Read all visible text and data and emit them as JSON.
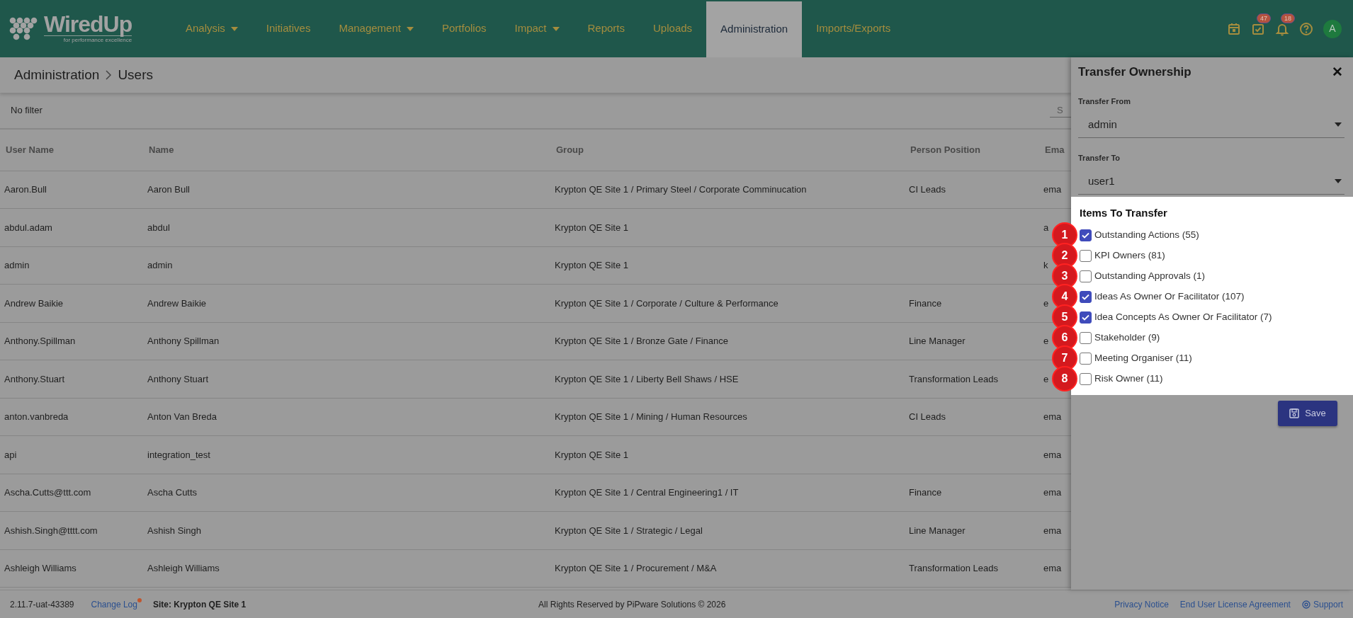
{
  "brand": {
    "name": "WiredUp",
    "tagline": "for performance excellence"
  },
  "nav": [
    {
      "label": "Analysis",
      "dropdown": true,
      "selected": false
    },
    {
      "label": "Initiatives",
      "dropdown": false,
      "selected": false
    },
    {
      "label": "Management",
      "dropdown": true,
      "selected": false
    },
    {
      "label": "Portfolios",
      "dropdown": false,
      "selected": false
    },
    {
      "label": "Impact",
      "dropdown": true,
      "selected": false
    },
    {
      "label": "Reports",
      "dropdown": false,
      "selected": false
    },
    {
      "label": "Uploads",
      "dropdown": false,
      "selected": false
    },
    {
      "label": "Administration",
      "dropdown": false,
      "selected": true
    },
    {
      "label": "Imports/Exports",
      "dropdown": false,
      "selected": false
    }
  ],
  "header_icons": [
    {
      "kind": "calendar"
    },
    {
      "kind": "tasks",
      "badge": "47"
    },
    {
      "kind": "bell",
      "badge": "18"
    },
    {
      "kind": "help"
    },
    {
      "kind": "avatar",
      "label": "A"
    }
  ],
  "breadcrumb": [
    "Administration",
    "Users"
  ],
  "filter": {
    "label": "No filter",
    "search_placeholder": "S"
  },
  "table": {
    "columns": [
      "User Name",
      "Name",
      "Group",
      "Person Position",
      "Ema"
    ],
    "rows": [
      [
        "Aaron.Bull",
        "Aaron Bull",
        "Krypton QE Site 1 / Primary Steel / Corporate Comminucation",
        "CI Leads",
        "ema"
      ],
      [
        "abdul.adam",
        "abdul",
        "Krypton QE Site 1",
        "",
        "a"
      ],
      [
        "admin",
        "admin",
        "Krypton QE Site 1",
        "",
        "k"
      ],
      [
        "Andrew Baikie",
        "Andrew Baikie",
        "Krypton QE Site 1 / Corporate / Culture & Performance",
        "Finance",
        "e"
      ],
      [
        "Anthony.Spillman",
        "Anthony Spillman",
        "Krypton QE Site 1 / Bronze Gate / Finance",
        "Line Manager",
        "e"
      ],
      [
        "Anthony.Stuart",
        "Anthony Stuart",
        "Krypton QE Site 1 / Liberty Bell Shaws / HSE",
        "Transformation Leads",
        "e"
      ],
      [
        "anton.vanbreda",
        "Anton Van Breda",
        "Krypton QE Site 1 / Mining / Human Resources",
        "CI Leads",
        "ema"
      ],
      [
        "api",
        "integration_test",
        "Krypton QE Site 1",
        "",
        "ema"
      ],
      [
        "Ascha.Cutts@ttt.com",
        "Ascha Cutts",
        "Krypton QE Site 1 / Central Engineering1 / IT",
        "Finance",
        "ema"
      ],
      [
        "Ashish.Singh@tttt.com",
        "Ashish Singh",
        "Krypton QE Site 1 / Strategic / Legal",
        "Line Manager",
        "ema"
      ],
      [
        "Ashleigh Williams",
        "Ashleigh Williams",
        "Krypton QE Site 1 / Procurement / M&A",
        "Transformation Leads",
        "ema"
      ]
    ]
  },
  "panel": {
    "title": "Transfer Ownership",
    "close": "✕",
    "fields": [
      {
        "label": "Transfer From",
        "value": "admin"
      },
      {
        "label": "Transfer To",
        "value": "user1"
      }
    ],
    "items_title": "Items To Transfer",
    "items": [
      {
        "marker": "1",
        "label": "Outstanding Actions (55)",
        "checked": true
      },
      {
        "marker": "2",
        "label": "KPI Owners (81)",
        "checked": false
      },
      {
        "marker": "3",
        "label": "Outstanding Approvals (1)",
        "checked": false
      },
      {
        "marker": "4",
        "label": "Ideas As Owner Or Facilitator (107)",
        "checked": true
      },
      {
        "marker": "5",
        "label": "Idea Concepts As Owner Or Facilitator (7)",
        "checked": true
      },
      {
        "marker": "6",
        "label": "Stakeholder (9)",
        "checked": false
      },
      {
        "marker": "7",
        "label": "Meeting Organiser (11)",
        "checked": false
      },
      {
        "marker": "8",
        "label": "Risk Owner (11)",
        "checked": false
      }
    ],
    "save": "Save"
  },
  "footer": {
    "version": "2.11.7-uat-43389",
    "change_log": "Change Log",
    "site": "Site: Krypton QE Site 1",
    "copyright": "All Rights Reserved by PiPware Solutions © 2026",
    "links": [
      "Privacy Notice",
      "End User License Agreement",
      "Support"
    ]
  }
}
